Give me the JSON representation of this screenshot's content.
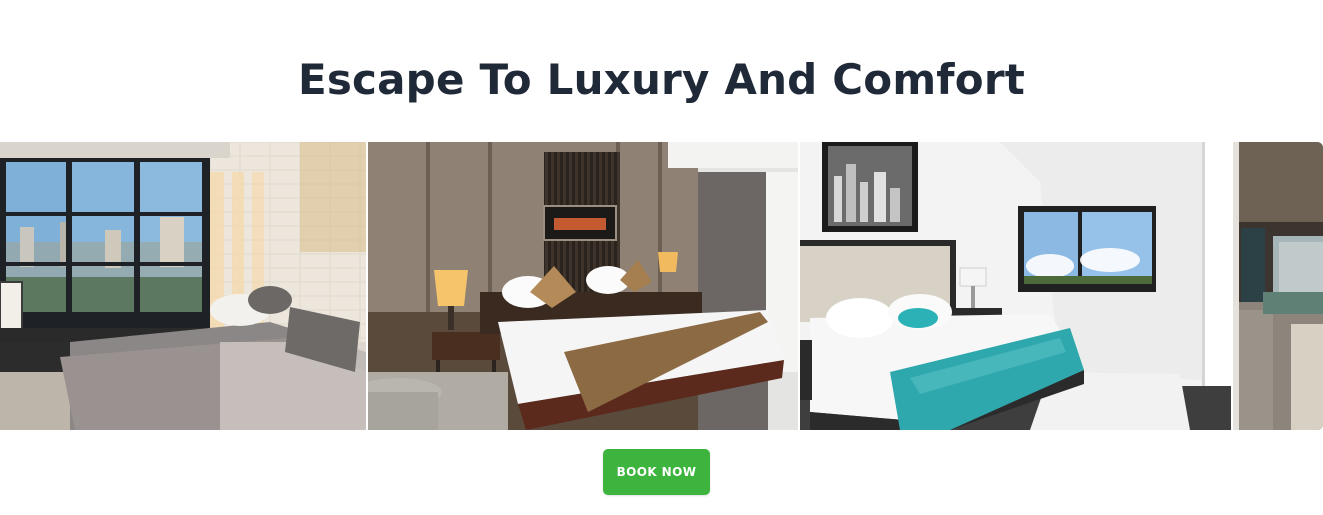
{
  "hero": {
    "title": "Escape To Luxury And Comfort"
  },
  "gallery": {
    "photos": [
      {
        "subject": "sunlit-bedroom-photo"
      },
      {
        "subject": "hotel-suite-bedroom-photo"
      },
      {
        "subject": "modern-bedroom-teal-throw-photo"
      },
      {
        "subject": "lounge-room-photo"
      }
    ]
  },
  "cta": {
    "label": "BOOK NOW"
  },
  "colors": {
    "heading": "#1f2937",
    "button": "#3db43d",
    "button_text": "#ffffff",
    "background": "#ffffff"
  }
}
